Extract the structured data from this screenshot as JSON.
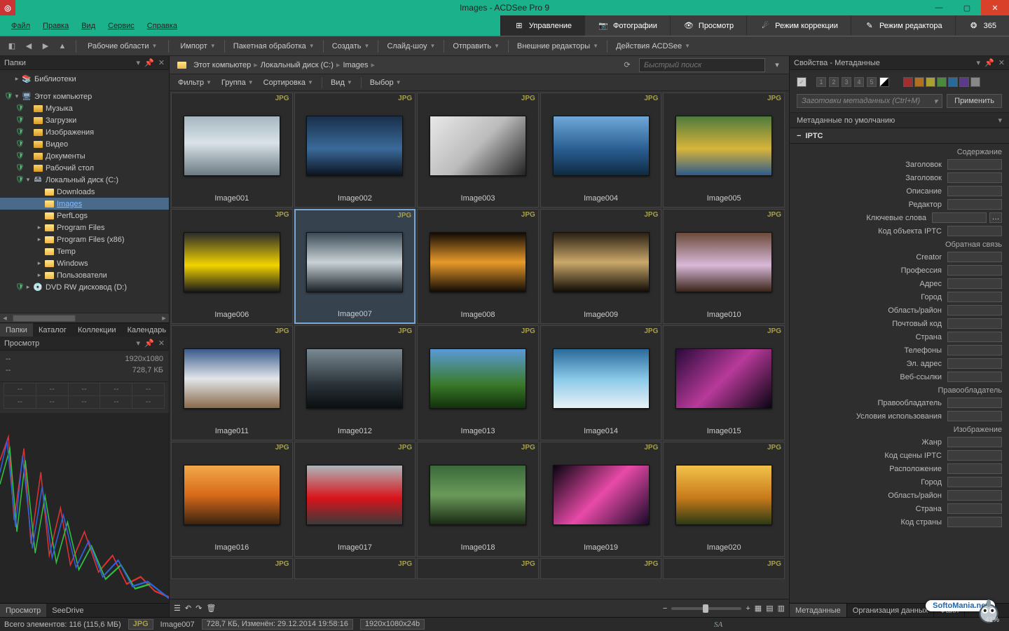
{
  "window": {
    "title": "Images - ACDSee Pro 9"
  },
  "menus": [
    "Файл",
    "Правка",
    "Вид",
    "Сервис",
    "Справка"
  ],
  "modes": [
    {
      "label": "Управление",
      "active": true,
      "icon": "grid"
    },
    {
      "label": "Фотографии",
      "active": false,
      "icon": "camera"
    },
    {
      "label": "Просмотр",
      "active": false,
      "icon": "eye"
    },
    {
      "label": "Режим коррекции",
      "active": false,
      "icon": "develop"
    },
    {
      "label": "Режим редактора",
      "active": false,
      "icon": "edit"
    },
    {
      "label": "365",
      "active": false,
      "icon": "365"
    }
  ],
  "toolbar": {
    "workspaces": "Рабочие области",
    "items": [
      "Импорт",
      "Пакетная обработка",
      "Создать",
      "Слайд-шоу",
      "Отправить",
      "Внешние редакторы",
      "Действия ACDSee"
    ]
  },
  "left": {
    "title": "Папки",
    "tree": [
      {
        "indent": 0,
        "tw": "▸",
        "label": "Библиотеки",
        "icon": "lib"
      },
      {
        "indent": 0,
        "tw": "",
        "label": "",
        "spacer": true
      },
      {
        "indent": 0,
        "tw": "▾",
        "label": "Этот компьютер",
        "icon": "pc",
        "shield": true
      },
      {
        "indent": 1,
        "tw": "",
        "label": "Музыка",
        "icon": "folder",
        "shield": true
      },
      {
        "indent": 1,
        "tw": "",
        "label": "Загрузки",
        "icon": "folder",
        "shield": true
      },
      {
        "indent": 1,
        "tw": "",
        "label": "Изображения",
        "icon": "folder",
        "shield": true
      },
      {
        "indent": 1,
        "tw": "",
        "label": "Видео",
        "icon": "folder",
        "shield": true
      },
      {
        "indent": 1,
        "tw": "",
        "label": "Документы",
        "icon": "folder",
        "shield": true
      },
      {
        "indent": 1,
        "tw": "",
        "label": "Рабочий стол",
        "icon": "folder",
        "shield": true
      },
      {
        "indent": 1,
        "tw": "▾",
        "label": "Локальный диск (C:)",
        "icon": "drive",
        "shield": true
      },
      {
        "indent": 2,
        "tw": "",
        "label": "Downloads",
        "icon": "ofolder"
      },
      {
        "indent": 2,
        "tw": "",
        "label": "Images",
        "icon": "ofolder",
        "selected": true
      },
      {
        "indent": 2,
        "tw": "",
        "label": "PerfLogs",
        "icon": "ofolder"
      },
      {
        "indent": 2,
        "tw": "▸",
        "label": "Program Files",
        "icon": "ofolder"
      },
      {
        "indent": 2,
        "tw": "▸",
        "label": "Program Files (x86)",
        "icon": "ofolder"
      },
      {
        "indent": 2,
        "tw": "",
        "label": "Temp",
        "icon": "ofolder"
      },
      {
        "indent": 2,
        "tw": "▸",
        "label": "Windows",
        "icon": "ofolder"
      },
      {
        "indent": 2,
        "tw": "▸",
        "label": "Пользователи",
        "icon": "ofolder"
      },
      {
        "indent": 1,
        "tw": "▸",
        "label": "DVD RW дисковод (D:)",
        "icon": "dvd",
        "shield": true
      }
    ],
    "tabs": [
      "Папки",
      "Каталог",
      "Коллекции",
      "Календарь"
    ],
    "preview": {
      "title": "Просмотр",
      "res": "1920x1080",
      "size": "728,7 КБ",
      "bottom_tabs": [
        "Просмотр",
        "SeeDrive"
      ]
    }
  },
  "breadcrumb": [
    "Этот компьютер",
    "Локальный диск (C:)",
    "Images"
  ],
  "search_placeholder": "Быстрый поиск",
  "filters": [
    "Фильтр",
    "Группа",
    "Сортировка",
    "Вид",
    "Выбор"
  ],
  "thumbs": [
    {
      "name": "Image001",
      "badge": "JPG",
      "g": "linear-gradient(180deg,#a6b7c2 0%,#d9e2e7 45%,#6b7b84 100%)"
    },
    {
      "name": "Image002",
      "badge": "JPG",
      "g": "linear-gradient(180deg,#1a2f4a 0%,#3a6a9a 55%,#0c1420 100%)"
    },
    {
      "name": "Image003",
      "badge": "JPG",
      "g": "linear-gradient(135deg,#e8e8e8 0%,#bcbcbc 50%,#222 100%)"
    },
    {
      "name": "Image004",
      "badge": "JPG",
      "g": "linear-gradient(180deg,#6fa8d8 0%,#2a5f93 55%,#0e2a40 100%)"
    },
    {
      "name": "Image005",
      "badge": "JPG",
      "g": "linear-gradient(180deg,#4e7a3c 0%,#d8b43a 55%,#2d5a8c 100%)"
    },
    {
      "name": "Image006",
      "badge": "JPG",
      "g": "linear-gradient(180deg,#2a2a2a 0%,#f2d400 55%,#1a1a1a 100%)"
    },
    {
      "name": "Image007",
      "badge": "JPG",
      "g": "linear-gradient(180deg,#3a4a55 0%,#c9d2d6 50%,#1a2228 100%)",
      "selected": true
    },
    {
      "name": "Image008",
      "badge": "JPG",
      "g": "linear-gradient(180deg,#120b06 0%,#e89a2a 50%,#120b06 100%)"
    },
    {
      "name": "Image009",
      "badge": "JPG",
      "g": "linear-gradient(180deg,#2a2014 0%,#caa86a 50%,#120c06 100%)"
    },
    {
      "name": "Image010",
      "badge": "JPG",
      "g": "linear-gradient(180deg,#6b4a3a 0%,#d8b8d8 55%,#3a2418 100%)"
    },
    {
      "name": "Image011",
      "badge": "JPG",
      "g": "linear-gradient(180deg,#3a5a8c 0%,#e2e6ea 50%,#8a6a4a 100%)"
    },
    {
      "name": "Image012",
      "badge": "JPG",
      "g": "linear-gradient(180deg,#7a8a92 0%,#2a3238 60%,#0a0e10 100%)"
    },
    {
      "name": "Image013",
      "badge": "JPG",
      "g": "linear-gradient(180deg,#5a9ad6 0%,#3a7a2a 60%,#12300c 100%)"
    },
    {
      "name": "Image014",
      "badge": "JPG",
      "g": "linear-gradient(180deg,#2a6a9a 0%,#8ac8e8 50%,#e8f2f6 100%)"
    },
    {
      "name": "Image015",
      "badge": "JPG",
      "g": "linear-gradient(135deg,#2a0a3a 0%,#b83a9a 50%,#0a0412 100%)"
    },
    {
      "name": "Image016",
      "badge": "JPG",
      "g": "linear-gradient(180deg,#f2a84a 0%,#d86a1a 50%,#3a2410 100%)"
    },
    {
      "name": "Image017",
      "badge": "JPG",
      "g": "linear-gradient(180deg,#aeb6ba 0%,#d8141a 55%,#3a3a3a 100%)"
    },
    {
      "name": "Image018",
      "badge": "JPG",
      "g": "linear-gradient(180deg,#3a6a3a 0%,#6a9a5a 50%,#1a2a14 100%)"
    },
    {
      "name": "Image019",
      "badge": "JPG",
      "g": "linear-gradient(135deg,#0a0410 0%,#e84aa8 50%,#1a0a28 100%)"
    },
    {
      "name": "Image020",
      "badge": "JPG",
      "g": "linear-gradient(180deg,#f2c24a 0%,#c87a1a 55%,#2a3a14 100%)"
    }
  ],
  "right": {
    "title": "Свойства - Метаданные",
    "preset_placeholder": "Заготовки метаданных (Ctrl+M)",
    "apply": "Применить",
    "default": "Метаданные по умолчанию",
    "iptc": "IPTC",
    "sections": [
      {
        "title": "Содержание",
        "fields": [
          "Заголовок",
          "Заголовок",
          "Описание",
          "Редактор",
          "Ключевые слова",
          "Код объекта IPTC"
        ],
        "more_at": 4
      },
      {
        "title": "Обратная связь",
        "fields": [
          "Creator",
          "Профессия",
          "Адрес",
          "Город",
          "Область/район",
          "Почтовый код",
          "Страна",
          "Телефоны",
          "Эл. адрес",
          "Веб-ссылки"
        ]
      },
      {
        "title": "Правообладатель",
        "fields": [
          "Правообладатель",
          "Условия использования"
        ]
      },
      {
        "title": "Изображение",
        "fields": [
          "Жанр",
          "Код сцены IPTC",
          "Расположение",
          "Город",
          "Область/район",
          "Страна",
          "Код страны"
        ]
      }
    ],
    "tabs": [
      "Метаданные",
      "Организация данных",
      "Файл"
    ],
    "colors": [
      "#a03030",
      "#b07020",
      "#a8a030",
      "#4a8a3a",
      "#2a6a9a",
      "#5a3a8a",
      "#888"
    ]
  },
  "status": {
    "total": "Всего элементов: 116  (115,6 МБ)",
    "fmt": "JPG",
    "name": "Image007",
    "info": "728,7 КБ, Изменён: 29.12.2014 19:58:16",
    "dim": "1920x1080x24b",
    "sa": "SA",
    "zoom": "41%"
  },
  "watermark": "SoftoMania.net"
}
